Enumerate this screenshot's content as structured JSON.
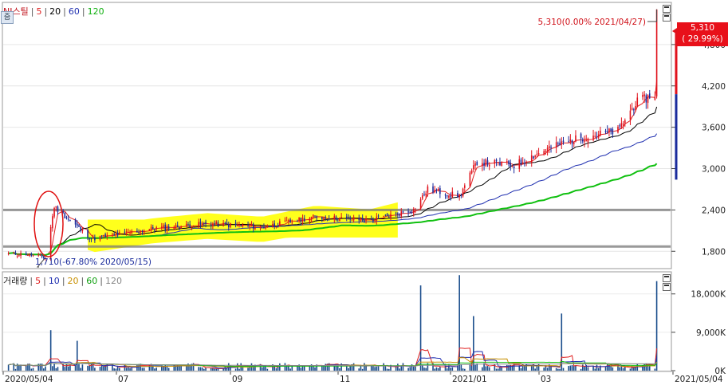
{
  "colors": {
    "up": "#e0121c",
    "down": "#1a2b9c",
    "ma5": "#e02020",
    "ma20": "#000000",
    "ma60": "#1f2fb0",
    "ma120": "#10c010",
    "highlight": "#ffff10",
    "box": "#777777"
  },
  "price_legend": {
    "stock_name": "NI스틸",
    "periods": [
      "5",
      "20",
      "60",
      "120"
    ],
    "zoom_label": "줌"
  },
  "volume_legend": {
    "title": "거래량",
    "periods": [
      "5",
      "10",
      "20",
      "60",
      "120"
    ]
  },
  "annotations": {
    "high": "5,310(0.00% 2021/04/27)",
    "low": "1,710(-67.80% 2020/05/15)",
    "current_price": "5,310",
    "current_change": "( 29.99%)"
  },
  "chart_data": [
    {
      "type": "candlestick",
      "title": "NI스틸",
      "series": [
        {
          "name": "5",
          "type": "line"
        },
        {
          "name": "20",
          "type": "line"
        },
        {
          "name": "60",
          "type": "line"
        },
        {
          "name": "120",
          "type": "line"
        }
      ],
      "x_ticks": [
        "2020/05/04",
        "07",
        "09",
        "11",
        "2021/01",
        "03",
        "2021/05/04"
      ],
      "y_ticks": [
        "1,800",
        "2,400",
        "3,000",
        "3,600",
        "4,200",
        "4,800"
      ],
      "ylim": [
        1560,
        5400
      ],
      "keypoints": [
        {
          "date": "2020/05/04",
          "close": 1760
        },
        {
          "date": "2020/05/15",
          "close": 1710
        },
        {
          "date": "2020/05/20",
          "close": 2450
        },
        {
          "date": "2020/06/10",
          "close": 1980
        },
        {
          "date": "2020/07/15",
          "close": 2130
        },
        {
          "date": "2020/08/15",
          "close": 2200
        },
        {
          "date": "2020/09/15",
          "close": 2150
        },
        {
          "date": "2020/10/15",
          "close": 2300
        },
        {
          "date": "2020/11/15",
          "close": 2250
        },
        {
          "date": "2020/12/10",
          "close": 2400
        },
        {
          "date": "2020/12/18",
          "close": 2700
        },
        {
          "date": "2021/01/05",
          "close": 2600
        },
        {
          "date": "2021/01/15",
          "close": 3100
        },
        {
          "date": "2021/02/05",
          "close": 3050
        },
        {
          "date": "2021/02/25",
          "close": 3300
        },
        {
          "date": "2021/03/15",
          "close": 3450
        },
        {
          "date": "2021/04/05",
          "close": 3550
        },
        {
          "date": "2021/04/15",
          "close": 3950
        },
        {
          "date": "2021/04/26",
          "close": 4085
        },
        {
          "date": "2021/04/27",
          "close": 5310
        }
      ],
      "high": {
        "value": 5310,
        "date": "2021/04/27",
        "pct": "0.00%"
      },
      "low": {
        "value": 1710,
        "date": "2020/05/15",
        "pct": "-67.80%"
      },
      "current": {
        "price": 5310,
        "change_pct": 29.99
      },
      "reference_lines": [
        2400,
        1870
      ]
    },
    {
      "type": "bar",
      "title": "거래량",
      "series": [
        {
          "name": "5",
          "type": "line"
        },
        {
          "name": "10",
          "type": "line"
        },
        {
          "name": "20",
          "type": "line"
        },
        {
          "name": "60",
          "type": "line"
        },
        {
          "name": "120",
          "type": "line"
        }
      ],
      "y_ticks": [
        "0K",
        "9,000K",
        "18,000K"
      ],
      "ylim": [
        0,
        23000
      ],
      "spikes": [
        {
          "date": "2020/05/18",
          "value": 9500
        },
        {
          "date": "2020/06/02",
          "value": 7000
        },
        {
          "date": "2020/12/14",
          "value": 20000
        },
        {
          "date": "2021/01/05",
          "value": 22400
        },
        {
          "date": "2021/01/13",
          "value": 12800
        },
        {
          "date": "2021/03/04",
          "value": 13400
        },
        {
          "date": "2021/04/27",
          "value": 21000
        }
      ]
    }
  ]
}
